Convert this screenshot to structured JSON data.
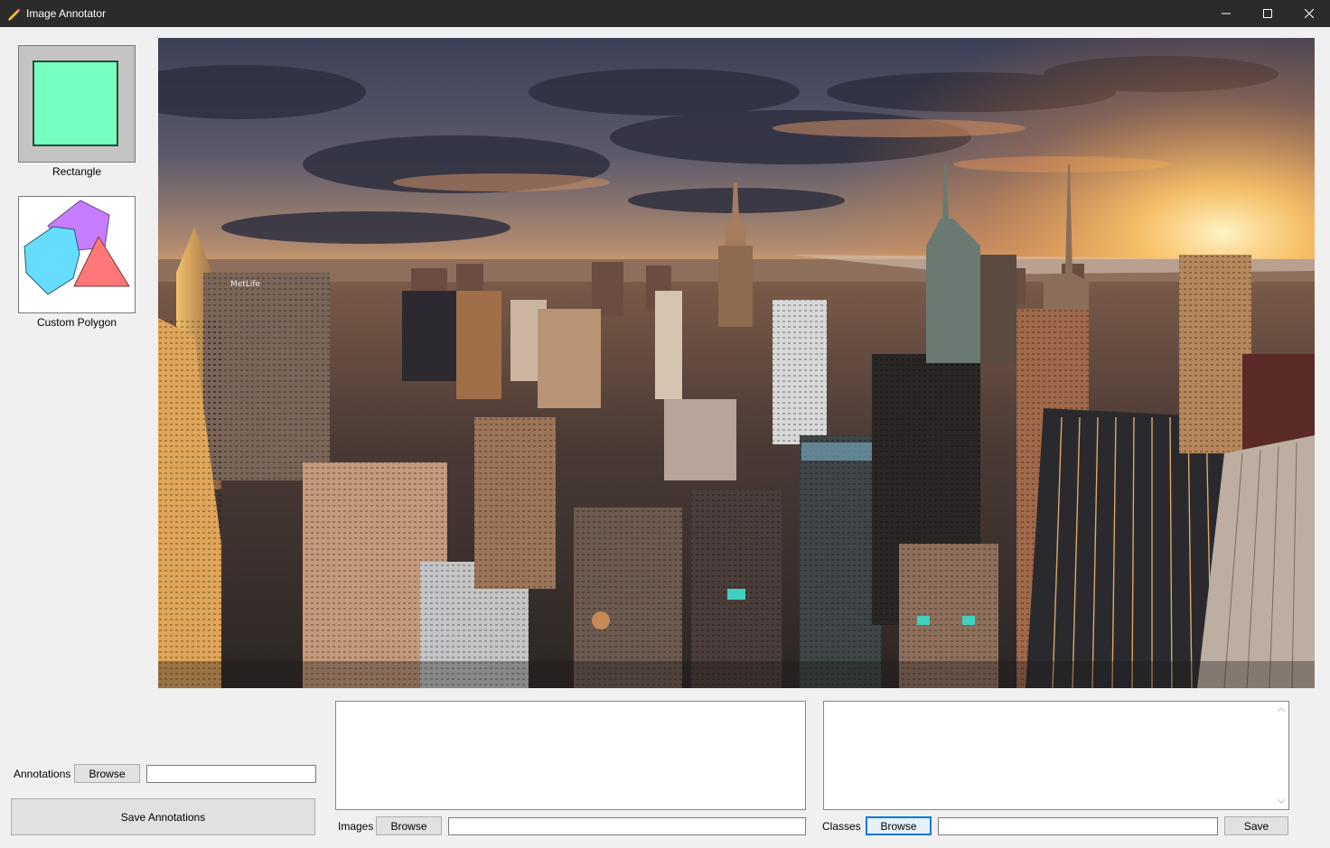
{
  "window": {
    "title": "Image Annotator",
    "icon": "pencil-icon",
    "controls": [
      "minimize-icon",
      "maximize-icon",
      "close-icon"
    ]
  },
  "tools": [
    {
      "label": "Rectangle",
      "icon": "rectangle-icon",
      "selected": true
    },
    {
      "label": "Custom Polygon",
      "icon": "polygon-icon",
      "selected": false
    }
  ],
  "canvas": {
    "image": "city-skyline-at-sunset"
  },
  "annotations": {
    "label": "Annotations",
    "browse_label": "Browse",
    "path_value": "",
    "save_label": "Save Annotations"
  },
  "images": {
    "label": "Images",
    "browse_label": "Browse",
    "path_value": "",
    "list": []
  },
  "classes": {
    "label": "Classes",
    "browse_label": "Browse",
    "path_value": "",
    "save_label": "Save",
    "list": []
  },
  "colors": {
    "titlebar": "#2b2b2b",
    "background": "#f0f0f0",
    "rect_fill": "#77ffc0",
    "rect_stroke": "#2a4a40",
    "pentagon": "#c77dff",
    "hexagon": "#66ddff",
    "triangle": "#ff7777",
    "focus": "#0078d7"
  }
}
